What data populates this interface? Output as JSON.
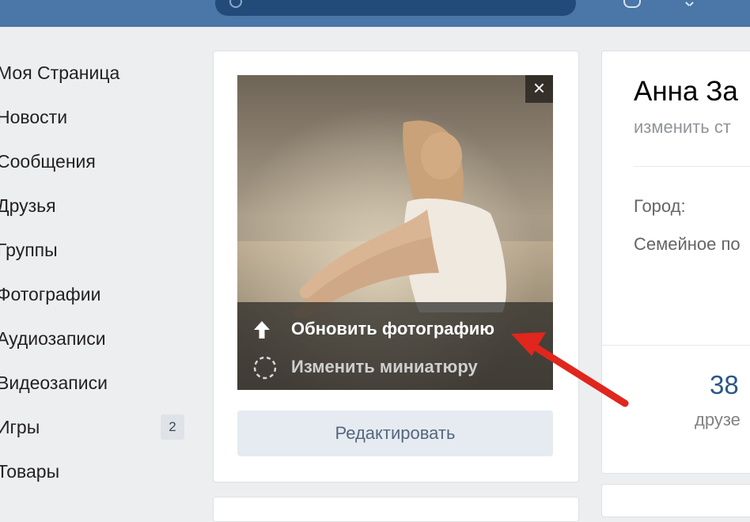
{
  "sidebar": {
    "items": [
      {
        "label": "Моя Страница"
      },
      {
        "label": "Новости"
      },
      {
        "label": "Сообщения"
      },
      {
        "label": "Друзья"
      },
      {
        "label": "Группы"
      },
      {
        "label": "Фотографии"
      },
      {
        "label": "Аудиозаписи"
      },
      {
        "label": "Видеозаписи"
      },
      {
        "label": "Игры",
        "counter": "2"
      },
      {
        "label": "Товары"
      }
    ]
  },
  "avatar_menu": {
    "close_label": "×",
    "update_photo_label": "Обновить фотографию",
    "change_thumbnail_label": "Изменить миниатюру",
    "update_icon": "upload-arrow-icon",
    "thumbnail_icon": "dashed-circle-icon"
  },
  "edit_button_label": "Редактировать",
  "profile": {
    "name": "Анна За",
    "status": "изменить ст",
    "city_label": "Город:",
    "family_label": "Семейное по",
    "friends_count": "38",
    "friends_label": "друзе"
  },
  "colors": {
    "header": "#4a76a8",
    "annotation_arrow": "#e0261d",
    "link": "#2a5885"
  }
}
